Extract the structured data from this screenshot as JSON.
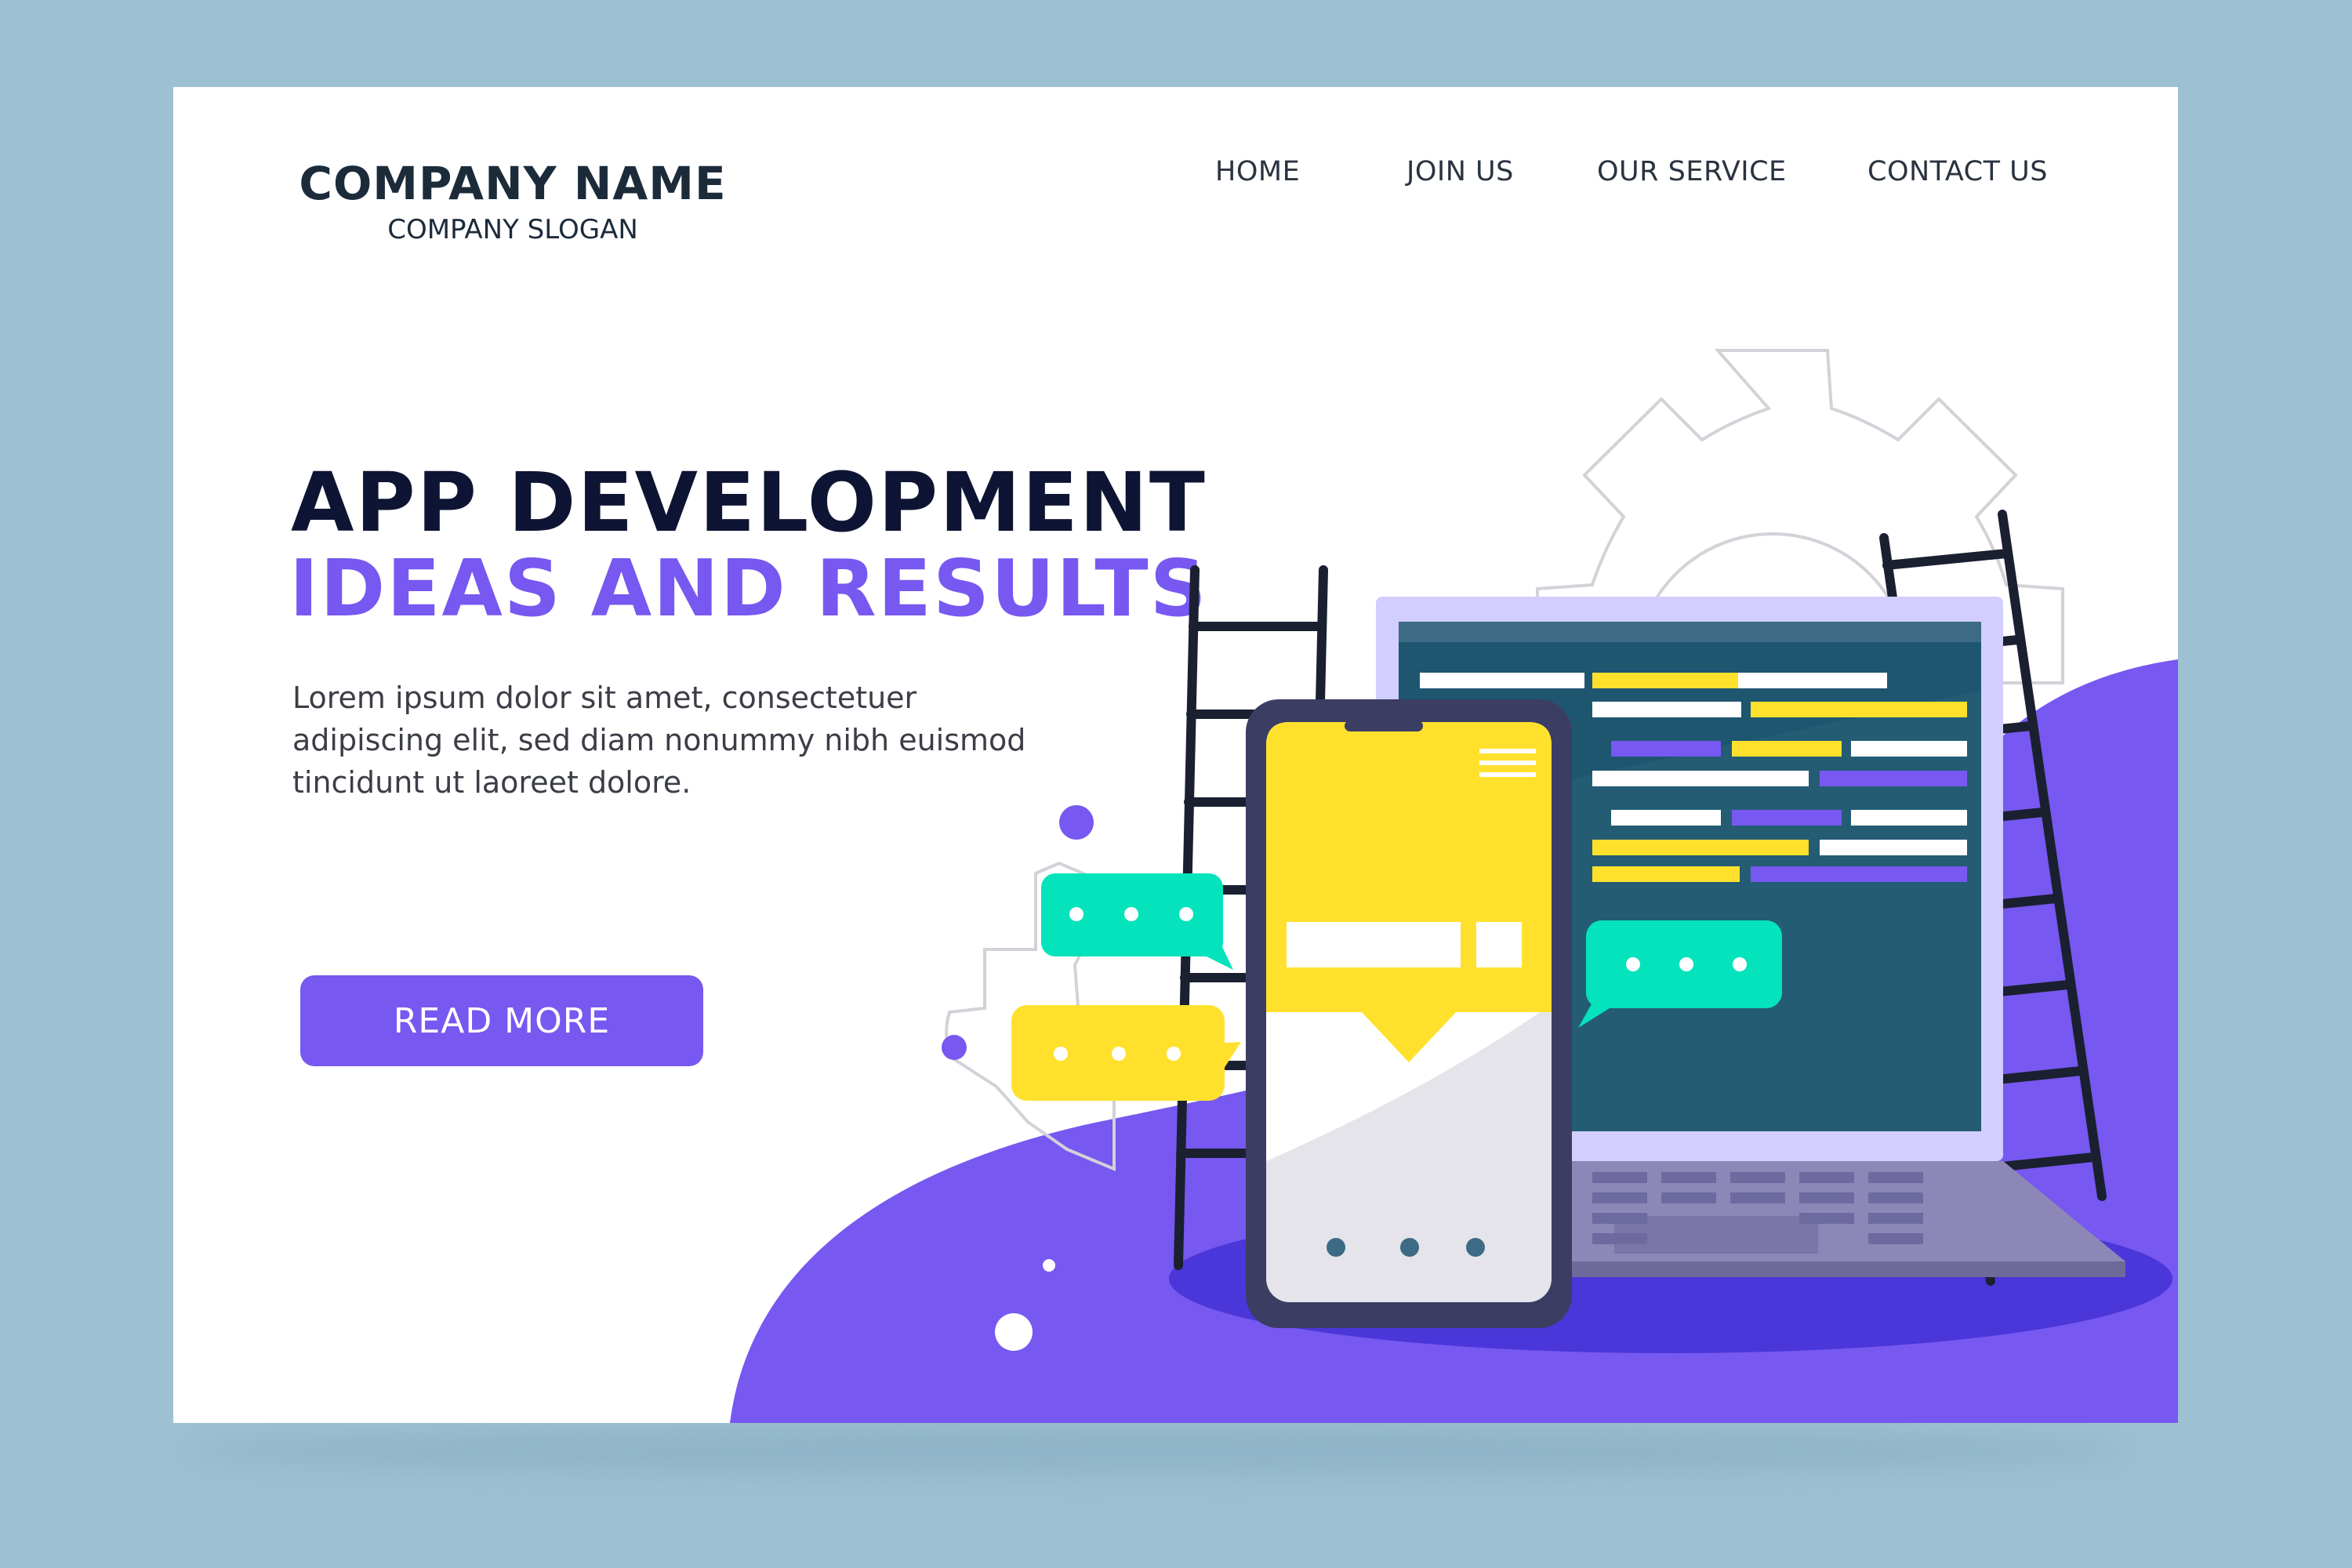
{
  "brand": {
    "name": "COMPANY NAME",
    "slogan": "COMPANY SLOGAN"
  },
  "nav": {
    "items": [
      {
        "label": "HOME"
      },
      {
        "label": "JOIN US"
      },
      {
        "label": "OUR SERVICE"
      },
      {
        "label": "CONTACT US"
      }
    ]
  },
  "hero": {
    "title": "APP DEVELOPMENT",
    "subtitle": "IDEAS AND RESULTS",
    "body": "Lorem ipsum dolor sit amet, consectetuer adipiscing elit, sed diam nonummy nibh euismod tincidunt ut laoreet dolore.",
    "cta_label": "READ MORE"
  },
  "colors": {
    "background": "#9dc0d3",
    "accent": "#7758f0",
    "heading": "#0e1433",
    "yellow": "#ffe12d",
    "teal": "#05e3bd",
    "screen": "#1e5670"
  },
  "illustration": {
    "icons": [
      "gear-icon",
      "ladder-icon",
      "phone-icon",
      "laptop-icon",
      "chat-bubble-icon",
      "menu-icon"
    ]
  }
}
